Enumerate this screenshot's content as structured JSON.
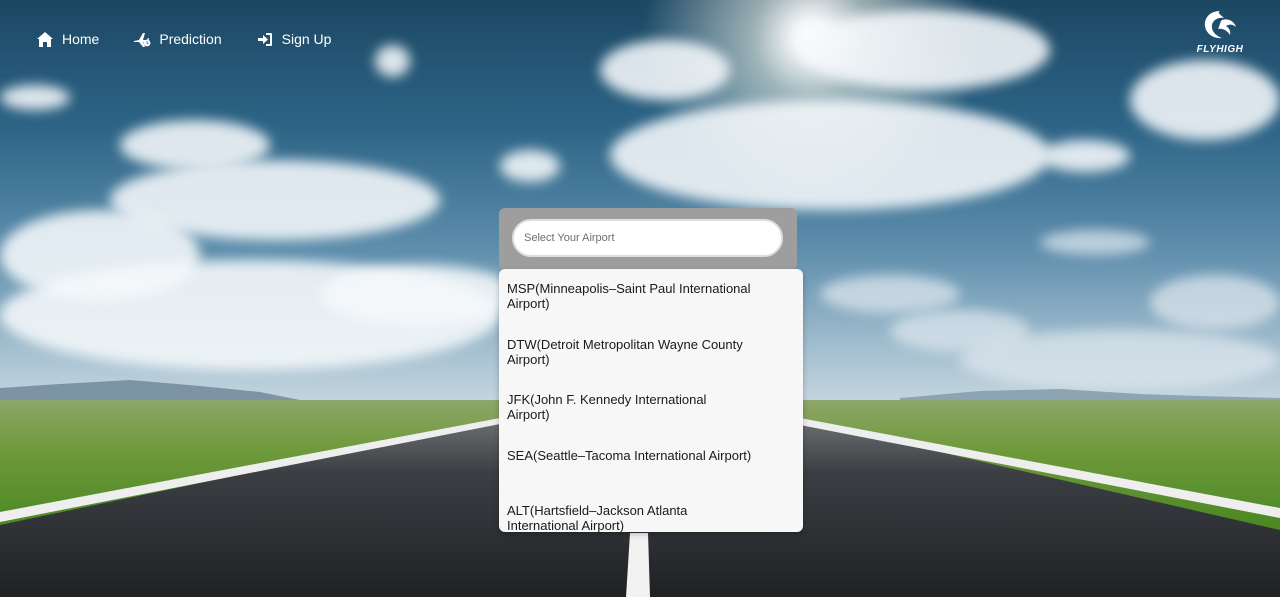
{
  "nav": {
    "items": [
      {
        "label": "Home",
        "icon": "home-icon"
      },
      {
        "label": "Prediction",
        "icon": "plane-clock-icon"
      },
      {
        "label": "Sign Up",
        "icon": "sign-in-icon"
      }
    ]
  },
  "logo": {
    "text": "FLYHIGH"
  },
  "search": {
    "placeholder": "Select Your Airport",
    "value": ""
  },
  "airports": [
    {
      "label": "MSP(Minneapolis–Saint Paul International Airport)"
    },
    {
      "label": "DTW(Detroit Metropolitan Wayne County Airport)"
    },
    {
      "label": "JFK(John F. Kennedy International Airport)"
    },
    {
      "label": "SEA(Seattle–Tacoma International Airport)"
    },
    {
      "label": "ALT(Hartsfield–Jackson Atlanta International Airport)"
    }
  ],
  "colors": {
    "selector_bg": "#9e9e9e",
    "dropdown_bg": "#f7f7f7",
    "nav_text": "#ffffff"
  }
}
